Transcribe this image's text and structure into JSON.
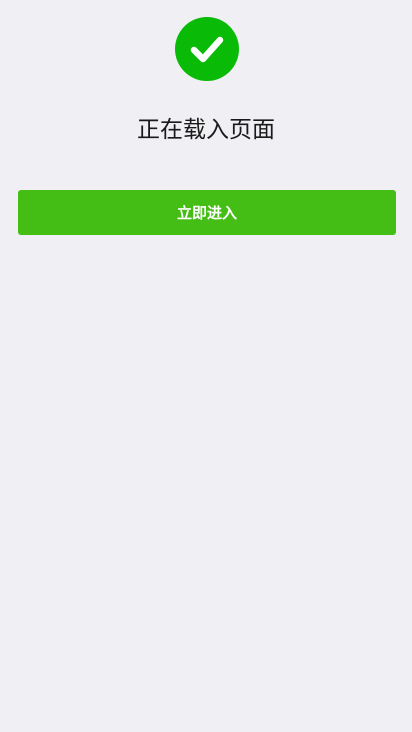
{
  "status": {
    "icon": "success-check-icon",
    "icon_color": "#09bb07",
    "title": "正在载入页面"
  },
  "actions": {
    "enter_label": "立即进入",
    "enter_color": "#44be15"
  },
  "colors": {
    "background": "#efeff4",
    "title_text": "#1a1a1a",
    "button_text": "#ffffff"
  }
}
